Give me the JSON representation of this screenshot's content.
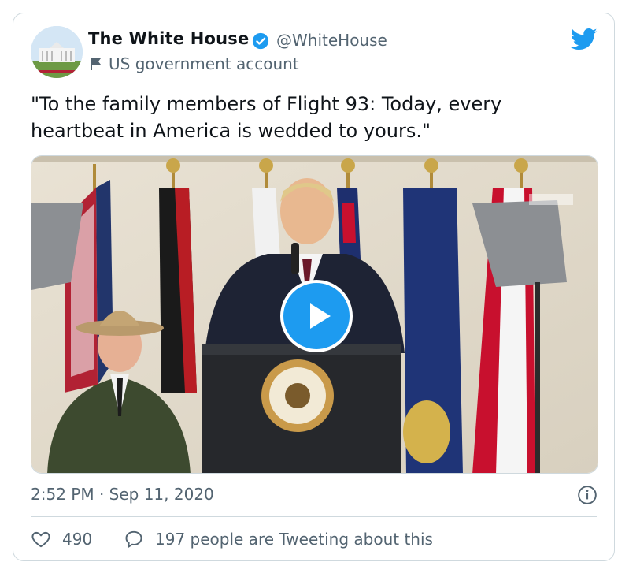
{
  "tweet": {
    "author_name": "The White House",
    "author_handle": "@WhiteHouse",
    "account_label": "US government account",
    "text": "\"To the family members of Flight 93: Today, every heartbeat in America is wedded to yours.\"",
    "timestamp": "2:52 PM · Sep 11, 2020",
    "likes": "490",
    "retweet_text": "197 people are Tweeting about this"
  },
  "icons": {
    "verified": "verified-badge-icon",
    "government": "flag-icon",
    "brand": "twitter-bird-icon",
    "play": "play-icon",
    "info": "info-icon",
    "like": "heart-icon",
    "reply": "speech-bubble-icon"
  },
  "colors": {
    "accent": "#1d9bf0",
    "secondary_text": "#536471",
    "border": "#cfd9de"
  }
}
